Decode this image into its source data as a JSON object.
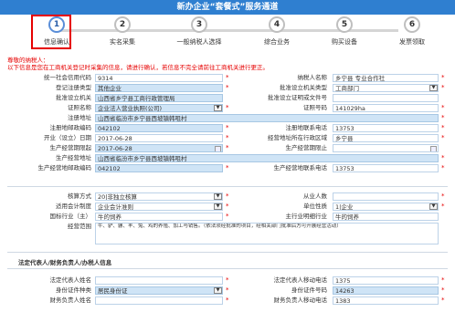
{
  "header": {
    "title": "新办企业“套餐式”服务通道"
  },
  "steps": [
    {
      "num": "1",
      "label": "信息确认"
    },
    {
      "num": "2",
      "label": "实名采集"
    },
    {
      "num": "3",
      "label": "一般纳税人选择"
    },
    {
      "num": "4",
      "label": "综合业务"
    },
    {
      "num": "5",
      "label": "购买设备"
    },
    {
      "num": "6",
      "label": "发票领取"
    }
  ],
  "notice": {
    "line1": "尊敬的纳税人：",
    "line2": "以下信息是您在工商机关登记时采集的信息，请进行确认，若信息不完全请前往工商机关进行更正。"
  },
  "form": {
    "credit_code_label": "统一社会信用代码",
    "credit_code": "9314",
    "taxpayer_name_label": "纳税人名称",
    "taxpayer_name": "乡宁县            专业合作社",
    "reg_type_label": "登记注册类型",
    "reg_type": "其他企业",
    "approve_type_label": "批准设立机关类型",
    "approve_type": "工商部门",
    "approve_org_label": "批准设立机关",
    "approve_org": "山西省乡宁县工商行政管理局",
    "approve_doc_label": "批准设立证明或文件号",
    "approve_doc": "",
    "cert_type_label": "证照名称",
    "cert_type": "企业法人营业执照(公司)",
    "cert_no_label": "证照号码",
    "cert_no": "141029ha",
    "reg_addr_label": "注册地址",
    "reg_addr": "山西省临汾市乡宁县西坡镇韩咀村",
    "reg_zip_label": "注册地邮政编码",
    "reg_zip": "042102",
    "reg_phone_label": "注册地联系电话",
    "reg_phone": "13753",
    "open_date_label": "开业（设立）日期",
    "open_date": "2017-06-28",
    "biz_area_label": "经营地址所在行政区域",
    "biz_area": "乡宁县",
    "biz_start_label": "生产经营期限起",
    "biz_start": "2017-06-28",
    "biz_end_label": "生产经营期限止",
    "biz_end": "",
    "biz_addr_label": "生产经营地址",
    "biz_addr": "山西省临汾市乡宁县西坡镇韩咀村",
    "biz_zip_label": "生产经营地邮政编码",
    "biz_zip": "042102",
    "biz_phone_label": "生产经营地联系电话",
    "biz_phone": "13753",
    "acc_method_label": "核算方式",
    "acc_method": "20|非独立核算",
    "employees_label": "从业人数",
    "employees": "",
    "acc_system_label": "适用会计制度",
    "acc_system": "企业会计准则",
    "unit_nature_label": "单位性质",
    "unit_nature": "1|企业",
    "industry_label": "国标行业（主）",
    "industry": "牛的饲养",
    "industry_detail_label": "主行业明细行业",
    "industry_detail": "牛的饲养",
    "scope_label": "经营范围",
    "scope": "牛、驴、骡、羊、兔、鸡的养殖、加工与销售。（依法须经批准的项目，经相关部门批准后方可开展经营活动）"
  },
  "section2": {
    "title": "法定代表人/财务负责人/办税人信息"
  },
  "person": {
    "legal_name_label": "法定代表人姓名",
    "legal_name": "",
    "legal_mobile_label": "法定代表人移动电话",
    "legal_mobile": "1375",
    "id_type_label": "身份证件种类",
    "id_type": "居民身份证",
    "id_no_label": "身份证件号码",
    "id_no": "14263",
    "fin_name_label": "财务负责人姓名",
    "fin_name": "",
    "fin_mobile_label": "财务负责人移动电话",
    "fin_mobile": "1383"
  }
}
